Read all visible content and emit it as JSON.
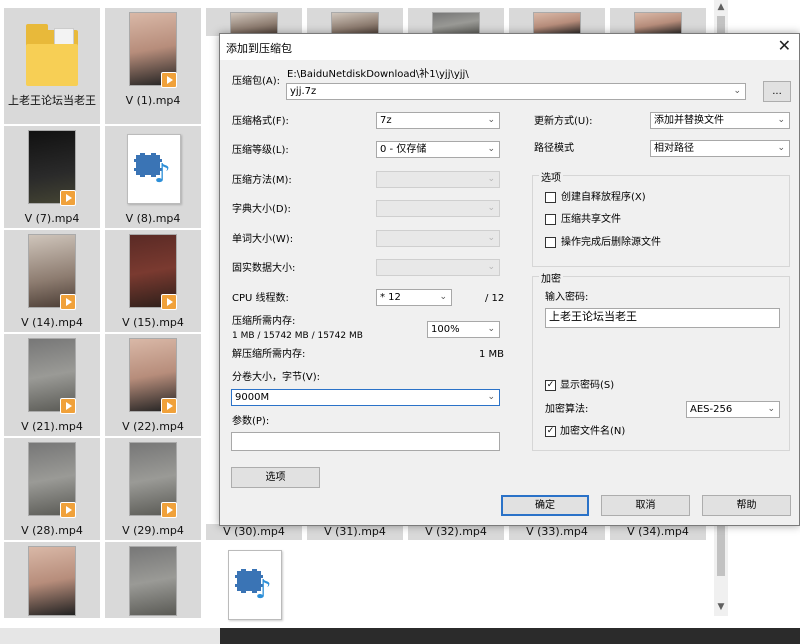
{
  "explorer": {
    "tiles": [
      {
        "label": "上老王论坛当老王",
        "kind": "folder"
      },
      {
        "label": "V (1).mp4",
        "kind": "video"
      },
      {
        "label": "",
        "kind": "video"
      },
      {
        "label": "",
        "kind": "video"
      },
      {
        "label": "",
        "kind": "video"
      },
      {
        "label": "",
        "kind": "video"
      },
      {
        "label": "",
        "kind": "video"
      },
      {
        "label": "V (7).mp4",
        "kind": "video"
      },
      {
        "label": "V (8).mp4",
        "kind": "media"
      },
      {
        "label": "V (14).mp4",
        "kind": "video"
      },
      {
        "label": "V (15).mp4",
        "kind": "video"
      },
      {
        "label": "V (21).mp4",
        "kind": "video"
      },
      {
        "label": "V (22).mp4",
        "kind": "video"
      },
      {
        "label": "V (28).mp4",
        "kind": "video"
      },
      {
        "label": "V (29).mp4",
        "kind": "video"
      },
      {
        "label": "V (30).mp4",
        "kind": "video"
      },
      {
        "label": "V (31).mp4",
        "kind": "video"
      },
      {
        "label": "V (32).mp4",
        "kind": "video"
      },
      {
        "label": "V (33).mp4",
        "kind": "video"
      },
      {
        "label": "V (34).mp4",
        "kind": "video"
      },
      {
        "label": "",
        "kind": "video"
      },
      {
        "label": "",
        "kind": "video"
      },
      {
        "label": "",
        "kind": "media"
      }
    ]
  },
  "dialog": {
    "title": "添加到压缩包",
    "close_glyph": "✕",
    "archive_label": "压缩包(A):",
    "archive_dir": "E:\\BaiduNetdiskDownload\\补1\\yjj\\yjj\\",
    "archive_name": "yjj.7z",
    "browse_label": "...",
    "chev": "⌄",
    "format_label": "压缩格式(F):",
    "format_value": "7z",
    "level_label": "压缩等级(L):",
    "level_value": "0 - 仅存储",
    "method_label": "压缩方法(M):",
    "dict_label": "字典大小(D):",
    "word_label": "单词大小(W):",
    "solid_label": "固实数据大小:",
    "cpu_label": "CPU 线程数:",
    "cpu_value": "* 12",
    "cpu_total": "/ 12",
    "mem_label": "压缩所需内存:",
    "mem_detail": "1 MB / 15742 MB / 15742 MB",
    "mem_percent": "100%",
    "decomp_label": "解压缩所需内存:",
    "decomp_value": "1 MB",
    "volume_label": "分卷大小，字节(V):",
    "volume_value": "9000M",
    "params_label": "参数(P):",
    "params_value": "",
    "options_button": "选项",
    "update_label": "更新方式(U):",
    "update_value": "添加并替换文件",
    "path_label": "路径模式",
    "path_value": "相对路径",
    "options_group": "选项",
    "opt_sfx": "创建自释放程序(X)",
    "opt_shared": "压缩共享文件",
    "opt_delete": "操作完成后删除源文件",
    "encrypt_group": "加密",
    "password_label": "输入密码:",
    "password_value": "上老王论坛当老王",
    "show_password": "显示密码(S)",
    "encrypt_method_label": "加密算法:",
    "encrypt_method_value": "AES-256",
    "encrypt_names": "加密文件名(N)",
    "check_glyph": "✓",
    "ok": "确定",
    "cancel": "取消",
    "help": "帮助"
  },
  "scrollbar": {
    "up": "▲",
    "down": "▼"
  }
}
